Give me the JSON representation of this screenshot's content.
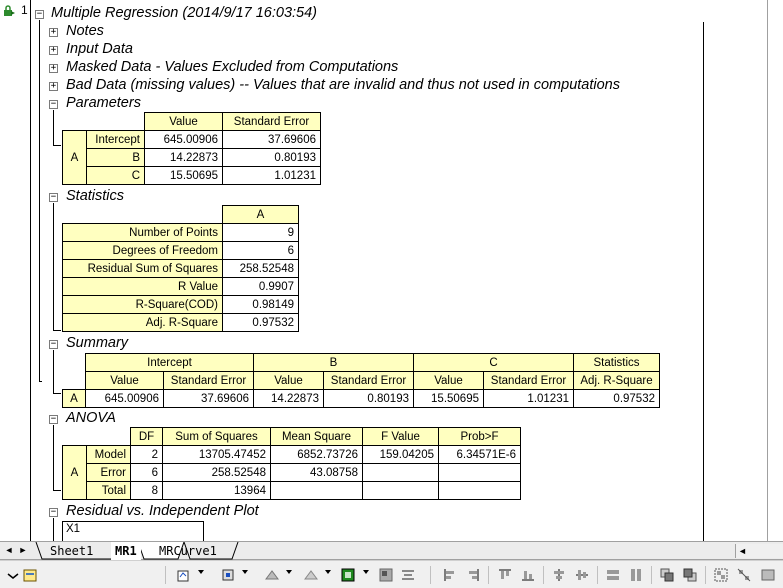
{
  "report": {
    "row_number": "1",
    "title": "Multiple Regression (2014/9/17 16:03:54)",
    "sections": {
      "notes": "Notes",
      "input_data": "Input Data",
      "masked_data": "Masked Data - Values Excluded from Computations",
      "bad_data": "Bad Data (missing values) -- Values that are invalid and thus not used in computations",
      "parameters": "Parameters",
      "statistics": "Statistics",
      "summary": "Summary",
      "anova": "ANOVA",
      "residual_plot": "Residual vs. Independent Plot"
    }
  },
  "parameters": {
    "headers": [
      "Value",
      "Standard Error"
    ],
    "group": "A",
    "rows": [
      {
        "label": "Intercept",
        "value": "645.00906",
        "se": "37.69606"
      },
      {
        "label": "B",
        "value": "14.22873",
        "se": "0.80193"
      },
      {
        "label": "C",
        "value": "15.50695",
        "se": "1.01231"
      }
    ]
  },
  "statistics": {
    "header": "A",
    "rows": [
      {
        "label": "Number of Points",
        "value": "9"
      },
      {
        "label": "Degrees of Freedom",
        "value": "6"
      },
      {
        "label": "Residual Sum of Squares",
        "value": "258.52548"
      },
      {
        "label": "R Value",
        "value": "0.9907"
      },
      {
        "label": "R-Square(COD)",
        "value": "0.98149"
      },
      {
        "label": "Adj. R-Square",
        "value": "0.97532"
      }
    ]
  },
  "summary": {
    "groups": [
      "Intercept",
      "B",
      "C",
      "Statistics"
    ],
    "subheaders": [
      "Value",
      "Standard Error",
      "Value",
      "Standard Error",
      "Value",
      "Standard Error",
      "Adj. R-Square"
    ],
    "row_label": "A",
    "values": [
      "645.00906",
      "37.69606",
      "14.22873",
      "0.80193",
      "15.50695",
      "1.01231",
      "0.97532"
    ]
  },
  "anova": {
    "headers": [
      "DF",
      "Sum of Squares",
      "Mean Square",
      "F Value",
      "Prob>F"
    ],
    "group": "A",
    "rows": [
      {
        "label": "Model",
        "df": "2",
        "ss": "13705.47452",
        "ms": "6852.73726",
        "f": "159.04205",
        "p": "6.34571E-6"
      },
      {
        "label": "Error",
        "df": "6",
        "ss": "258.52548",
        "ms": "43.08758",
        "f": "",
        "p": ""
      },
      {
        "label": "Total",
        "df": "8",
        "ss": "13964",
        "ms": "",
        "f": "",
        "p": ""
      }
    ]
  },
  "residual_plot": {
    "cell": "X1"
  },
  "sheet_tabs": [
    "Sheet1",
    "MR1",
    "MRCurve1"
  ],
  "active_tab": "MR1",
  "icons": {
    "lock": "lock-icon",
    "expand": "plus-box-icon",
    "collapse": "minus-box-icon"
  }
}
